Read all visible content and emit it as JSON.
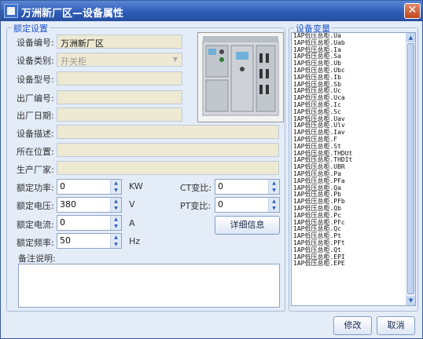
{
  "window": {
    "title": "万洲新厂区—设备属性",
    "close_label": "✕"
  },
  "rated": {
    "group_title": "额定设置",
    "device_no_label": "设备编号:",
    "device_no": "万洲新厂区",
    "device_type_label": "设备类别:",
    "device_type": "开关柜",
    "model_label": "设备型号:",
    "model": "",
    "factory_no_label": "出厂编号:",
    "factory_no": "",
    "factory_date_label": "出厂日期:",
    "factory_date": "",
    "desc_label": "设备描述:",
    "desc": "",
    "location_label": "所在位置:",
    "location": "",
    "maker_label": "生产厂家:",
    "maker": "",
    "power_label": "额定功率:",
    "power": "0",
    "power_unit": "KW",
    "voltage_label": "额定电压:",
    "voltage": "380",
    "voltage_unit": "V",
    "current_label": "额定电流:",
    "current": "0",
    "current_unit": "A",
    "freq_label": "额定频率:",
    "freq": "50",
    "freq_unit": "Hz",
    "ct_label": "CT变比:",
    "ct": "0",
    "pt_label": "PT变比:",
    "pt": "0",
    "detail_button": "详细信息",
    "remark_label": "备注说明:",
    "remark": ""
  },
  "variables": {
    "group_title": "设备变量",
    "items": [
      "1AP低压总柜.Ua",
      "1AP低压总柜.Uab",
      "1AP低压总柜.Ia",
      "1AP低压总柜.Sa",
      "1AP低压总柜.Ub",
      "1AP低压总柜.Ubc",
      "1AP低压总柜.Ib",
      "1AP低压总柜.Sb",
      "1AP低压总柜.Uc",
      "1AP低压总柜.Uca",
      "1AP低压总柜.Ic",
      "1AP低压总柜.Sc",
      "1AP低压总柜.Uav",
      "1AP低压总柜.Ulv",
      "1AP低压总柜.Iav",
      "1AP低压总柜.F",
      "1AP低压总柜.St",
      "1AP低压总柜.THDUt",
      "1AP低压总柜.THDIt",
      "1AP低压总柜.UBR",
      "1AP低压总柜.Pa",
      "1AP低压总柜.PFa",
      "1AP低压总柜.Qa",
      "1AP低压总柜.Pb",
      "1AP低压总柜.PFb",
      "1AP低压总柜.Qb",
      "1AP低压总柜.Pc",
      "1AP低压总柜.PFc",
      "1AP低压总柜.Qc",
      "1AP低压总柜.Pt",
      "1AP低压总柜.PFt",
      "1AP低压总柜.Qt",
      "1AP低压总柜.EPI",
      "1AP低压总柜.EPE"
    ]
  },
  "footer": {
    "modify_button": "修改",
    "cancel_button": "取消"
  }
}
